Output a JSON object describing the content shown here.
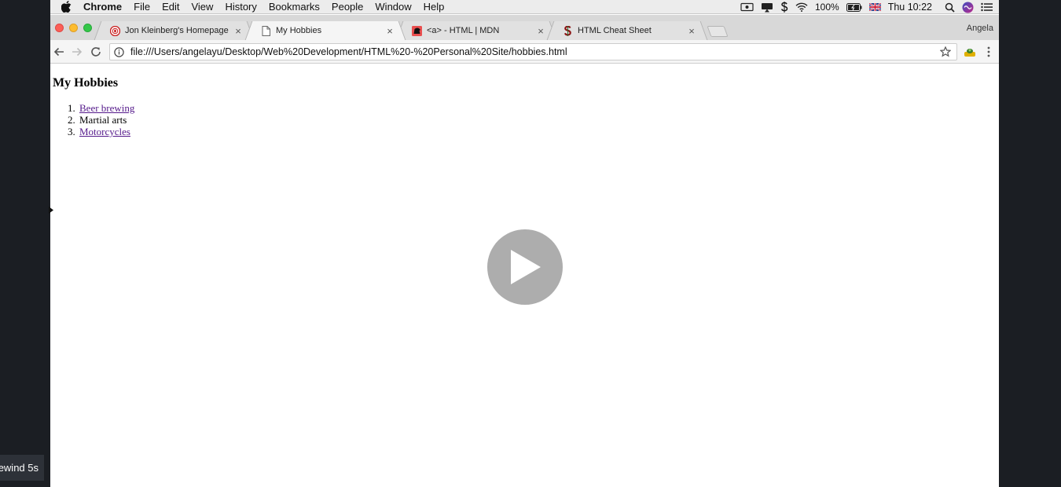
{
  "menubar": {
    "app_name": "Chrome",
    "items": [
      "File",
      "Edit",
      "View",
      "History",
      "Bookmarks",
      "People",
      "Window",
      "Help"
    ],
    "battery": "100%",
    "clock": "Thu 10:22"
  },
  "tabs": [
    {
      "title": "Jon Kleinberg's Homepage",
      "favicon": "cornell-seal-icon",
      "active": false
    },
    {
      "title": "My Hobbies",
      "favicon": "document-icon",
      "active": true
    },
    {
      "title": "<a> - HTML | MDN",
      "favicon": "mdn-icon",
      "active": false
    },
    {
      "title": "HTML Cheat Sheet",
      "favicon": "stanford-icon",
      "active": false
    }
  ],
  "profile_name": "Angela",
  "address_bar": {
    "url": "file:///Users/angelayu/Desktop/Web%20Development/HTML%20-%20Personal%20Site/hobbies.html"
  },
  "page": {
    "heading": "My Hobbies",
    "hobbies": [
      {
        "number": "1.",
        "label": "Beer brewing",
        "is_link": true
      },
      {
        "number": "2.",
        "label": "Martial arts",
        "is_link": false
      },
      {
        "number": "3.",
        "label": "Motorcycles",
        "is_link": true
      }
    ]
  },
  "video_overlay": {
    "rewind_label": "ewind 5s"
  },
  "colors": {
    "link_visited": "#551a8b",
    "play_button": "#adadad",
    "close_red": "#fc5f57",
    "minimize_yellow": "#fdbc2e",
    "zoom_green": "#33c748"
  }
}
